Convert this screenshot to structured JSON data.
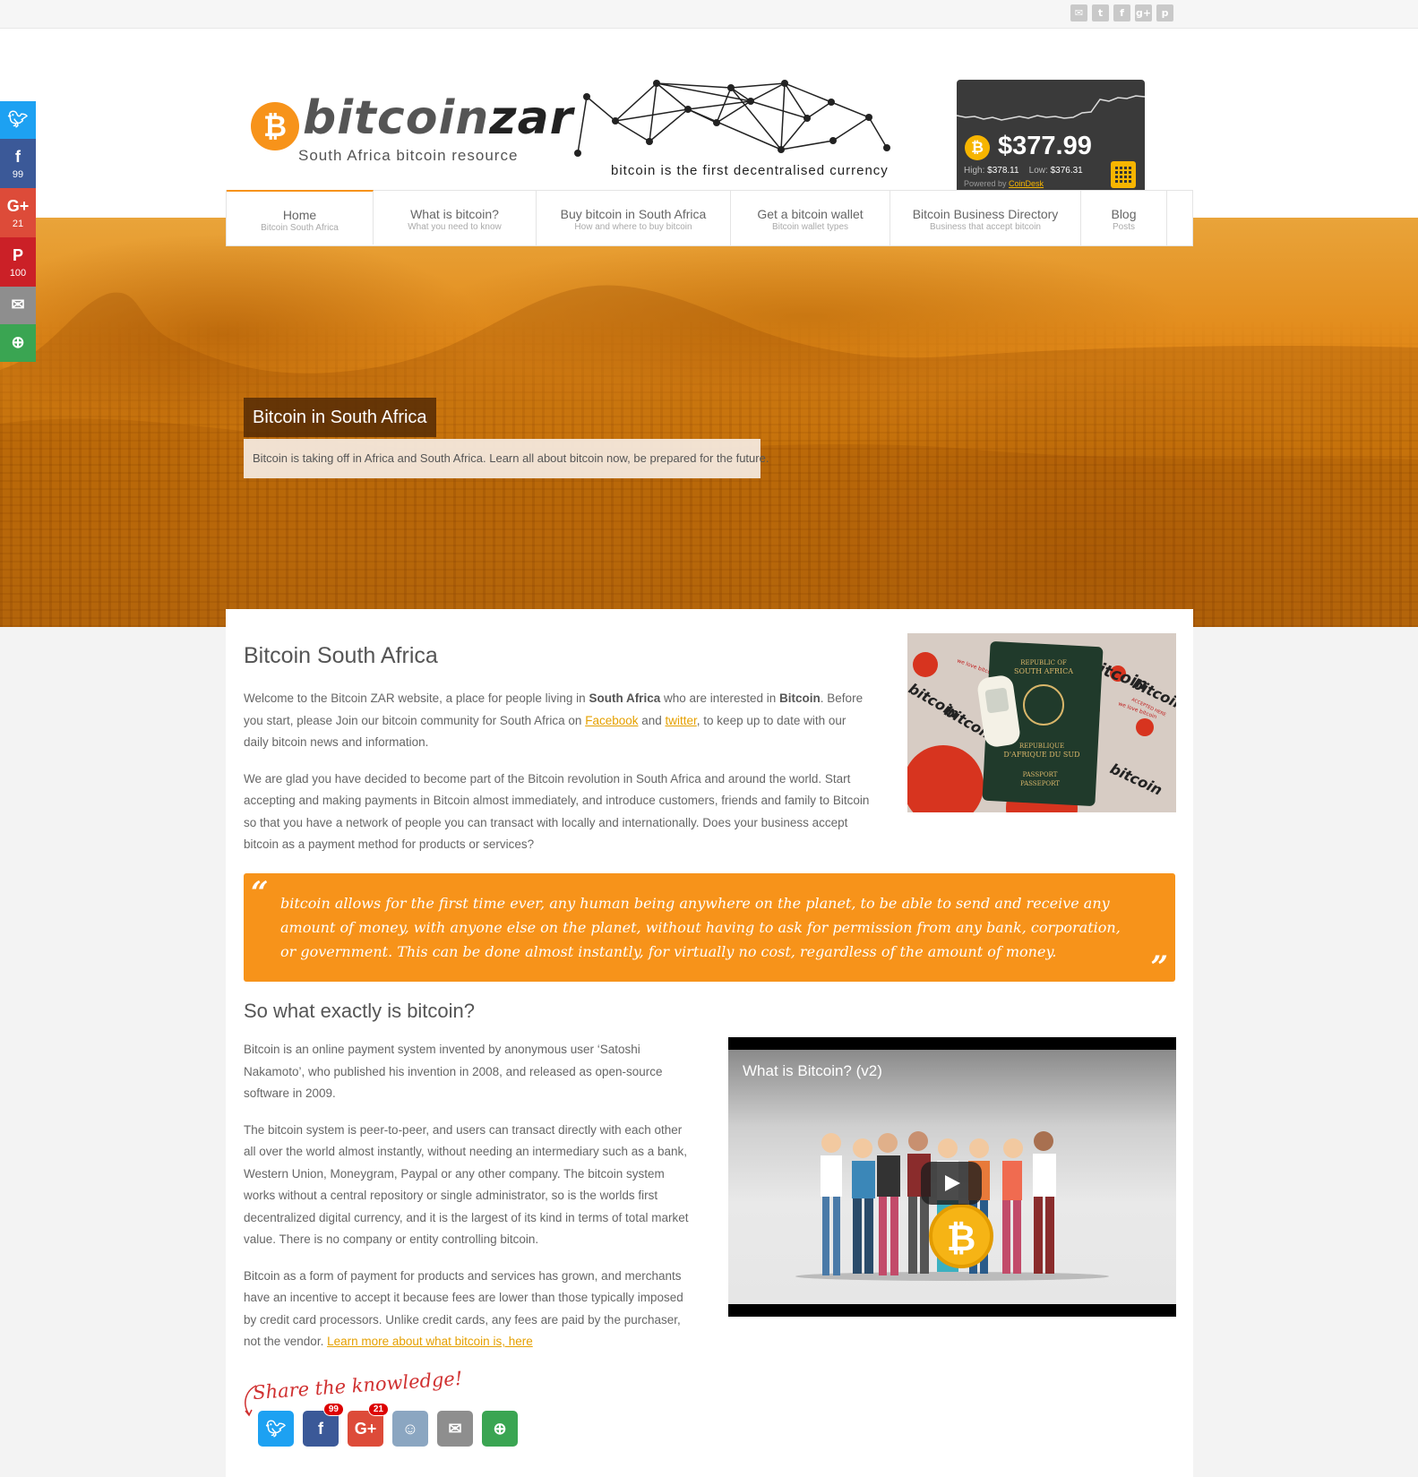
{
  "topbar": {
    "icons": [
      "mail-icon",
      "twitter-icon",
      "facebook-icon",
      "google-plus-icon",
      "pinterest-icon"
    ]
  },
  "logo": {
    "part1": "bitcoin",
    "part2": "zar",
    "tagline": "South Africa bitcoin resource"
  },
  "slogan": "bitcoin is the first decentralised currency",
  "ticker": {
    "price": "$377.99",
    "high_label": "High:",
    "high": "$378.11",
    "low_label": "Low:",
    "low": "$376.31",
    "powered_label": "Powered by",
    "powered_link": "CoinDesk",
    "accent": "#f7b500"
  },
  "nav": [
    {
      "title": "Home",
      "sub": "Bitcoin South Africa",
      "active": true
    },
    {
      "title": "What is bitcoin?",
      "sub": "What you need to know"
    },
    {
      "title": "Buy bitcoin in South Africa",
      "sub": "How and where to buy bitcoin"
    },
    {
      "title": "Get a bitcoin wallet",
      "sub": "Bitcoin wallet types"
    },
    {
      "title": "Bitcoin Business Directory",
      "sub": "Business that accept bitcoin"
    },
    {
      "title": "Blog",
      "sub": "Posts"
    }
  ],
  "hero": {
    "title": "Bitcoin in South Africa",
    "subtitle": "Bitcoin is taking off in Africa and South Africa. Learn all about bitcoin now, be prepared for the future."
  },
  "side_share": [
    {
      "name": "twitter",
      "glyph": "t",
      "count": "",
      "color": "#1da1f2"
    },
    {
      "name": "facebook",
      "glyph": "f",
      "count": "99",
      "color": "#3b5998"
    },
    {
      "name": "google-plus",
      "glyph": "G+",
      "count": "21",
      "color": "#dd4b39"
    },
    {
      "name": "pinterest",
      "glyph": "P",
      "count": "100",
      "color": "#cb2027"
    },
    {
      "name": "email",
      "glyph": "✉",
      "count": "",
      "color": "#8e8e8e"
    },
    {
      "name": "more",
      "glyph": "⊕",
      "count": "",
      "color": "#3aa552"
    }
  ],
  "main": {
    "heading": "Bitcoin South Africa",
    "p1_a": "Welcome to the Bitcoin ZAR website, a place for people living in ",
    "p1_b": "South Africa",
    "p1_c": " who are interested in ",
    "p1_d": "Bitcoin",
    "p1_e": ". Before you start, please Join our bitcoin community for South Africa on ",
    "p1_link1": "Facebook",
    "p1_f": " and ",
    "p1_link2": "twitter",
    "p1_g": ", to keep up to date with our daily bitcoin news and information.",
    "p2": "We are glad you have decided to become part of the Bitcoin revolution in South Africa and around the world. Start accepting and making payments in Bitcoin almost immediately, and introduce customers, friends and family to Bitcoin so that you have a network of people you can transact with locally and internationally. Does your business accept bitcoin as a payment method for products or services?",
    "quote": "bitcoin allows for the first time ever, any human being anywhere on the planet, to be able to send and receive any amount of money, with anyone else on the planet, without having to ask for permission from any bank, corporation, or government. This can be done almost instantly, for virtually no cost, regardless of the amount of money.",
    "heading2": "So what exactly is bitcoin?",
    "p3": "Bitcoin is an online payment system invented by anonymous user ‘Satoshi Nakamoto’, who published his invention in 2008, and released as open-source software in 2009.",
    "p4": "The bitcoin system is peer-to-peer, and users can transact directly with each other all over the world almost instantly, without needing an intermediary such as a bank, Western Union, Moneygram, Paypal or any other company. The bitcoin system works without a central repository or single administrator, so is the worlds first decentralized digital currency, and it is the largest of its kind in terms of total market value. There is no company or entity controlling bitcoin.",
    "p5": "Bitcoin as a form of payment for products and services has grown, and merchants have an incentive to accept it because fees are lower than those typically imposed by credit card processors. Unlike credit cards, any fees are paid by the purchaser, not the vendor. ",
    "p5_link": "Learn more about what bitcoin is, here",
    "video_title": "What is Bitcoin? (v2)",
    "share_title": "Share the knowledge!",
    "share_buttons": [
      {
        "name": "twitter",
        "glyph": "t",
        "badge": "",
        "color": "#1da1f2"
      },
      {
        "name": "facebook",
        "glyph": "f",
        "badge": "99",
        "color": "#3b5998"
      },
      {
        "name": "google-plus",
        "glyph": "G+",
        "badge": "21",
        "color": "#dd4b39"
      },
      {
        "name": "reddit",
        "glyph": "☺",
        "badge": "",
        "color": "#8ba6c1"
      },
      {
        "name": "email",
        "glyph": "✉",
        "badge": "",
        "color": "#8e8e8e"
      },
      {
        "name": "more",
        "glyph": "⊕",
        "badge": "",
        "color": "#3aa552"
      }
    ]
  },
  "photo": {
    "passport_line1": "REPUBLIC OF",
    "passport_line2": "SOUTH AFRICA",
    "passport_line3": "REPUBLIQUE",
    "passport_line4": "D'AFRIQUE DU SUD",
    "passport_line5": "PASSPORT",
    "passport_line6": "PASSEPORT",
    "sticker_text": "bitcoin",
    "sticker_sub": "ACCEPTED HERE",
    "sticker_love": "we love bitcoin"
  },
  "colors": {
    "brand": "#f7931a",
    "link": "#e5a000"
  }
}
